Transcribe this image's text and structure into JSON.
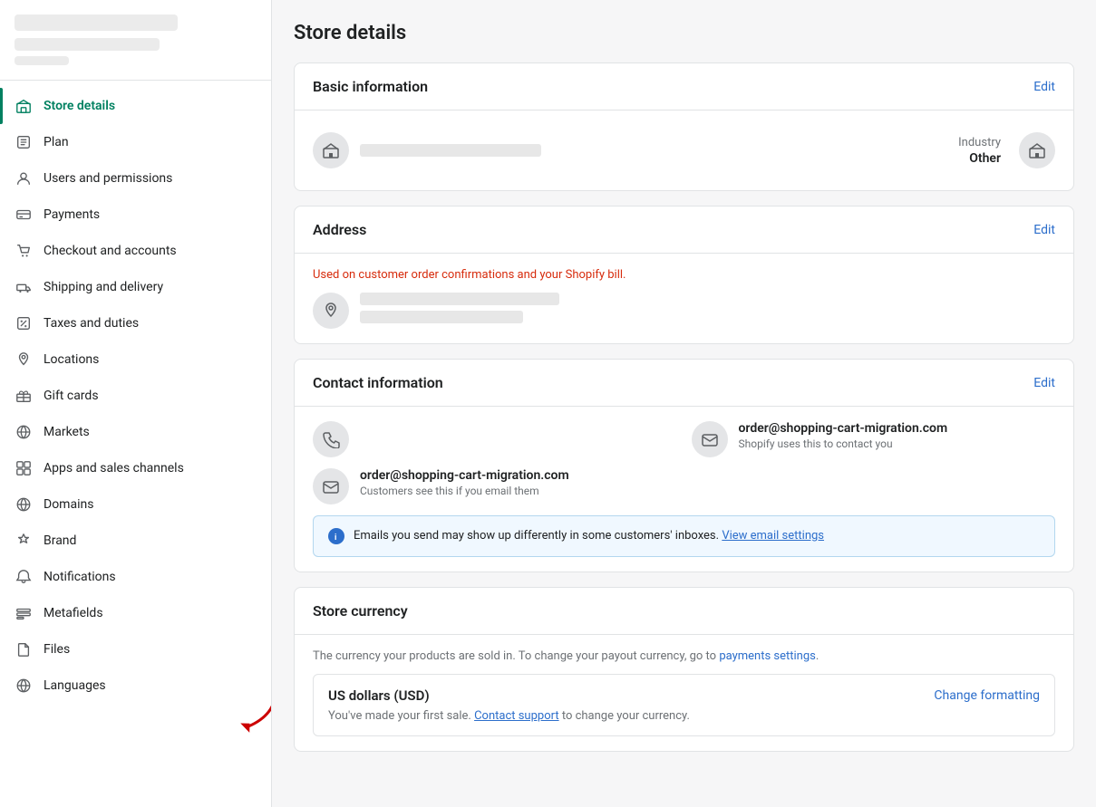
{
  "sidebar": {
    "items": [
      {
        "id": "store-details",
        "label": "Store details",
        "active": true
      },
      {
        "id": "plan",
        "label": "Plan",
        "active": false
      },
      {
        "id": "users-permissions",
        "label": "Users and permissions",
        "active": false
      },
      {
        "id": "payments",
        "label": "Payments",
        "active": false
      },
      {
        "id": "checkout-accounts",
        "label": "Checkout and accounts",
        "active": false
      },
      {
        "id": "shipping-delivery",
        "label": "Shipping and delivery",
        "active": false
      },
      {
        "id": "taxes-duties",
        "label": "Taxes and duties",
        "active": false
      },
      {
        "id": "locations",
        "label": "Locations",
        "active": false
      },
      {
        "id": "gift-cards",
        "label": "Gift cards",
        "active": false
      },
      {
        "id": "markets",
        "label": "Markets",
        "active": false
      },
      {
        "id": "apps-sales-channels",
        "label": "Apps and sales channels",
        "active": false
      },
      {
        "id": "domains",
        "label": "Domains",
        "active": false
      },
      {
        "id": "brand",
        "label": "Brand",
        "active": false
      },
      {
        "id": "notifications",
        "label": "Notifications",
        "active": false
      },
      {
        "id": "metafields",
        "label": "Metafields",
        "active": false
      },
      {
        "id": "files",
        "label": "Files",
        "active": false
      },
      {
        "id": "languages",
        "label": "Languages",
        "active": false
      }
    ]
  },
  "main": {
    "page_title": "Store details",
    "basic_info": {
      "section_title": "Basic information",
      "edit_label": "Edit",
      "industry_label": "Industry",
      "industry_value": "Other"
    },
    "address": {
      "section_title": "Address",
      "edit_label": "Edit",
      "subtitle": "Used on customer order confirmations and your Shopify bill."
    },
    "contact_info": {
      "section_title": "Contact information",
      "edit_label": "Edit",
      "email1": "order@shopping-cart-migration.com",
      "email1_note": "Shopify uses this to contact you",
      "email2": "order@shopping-cart-migration.com",
      "email2_note": "Customers see this if you email them",
      "banner_text": "Emails you send may show up differently in some customers' inboxes.",
      "banner_link": "View email settings"
    },
    "store_currency": {
      "section_title": "Store currency",
      "subtitle": "The currency your products are sold in. To change your payout currency, go to",
      "subtitle_link": "payments settings",
      "currency_name": "US dollars (USD)",
      "change_label": "Change formatting",
      "note": "You've made your first sale.",
      "note_link": "Contact support",
      "note_suffix": "to change your currency."
    }
  }
}
